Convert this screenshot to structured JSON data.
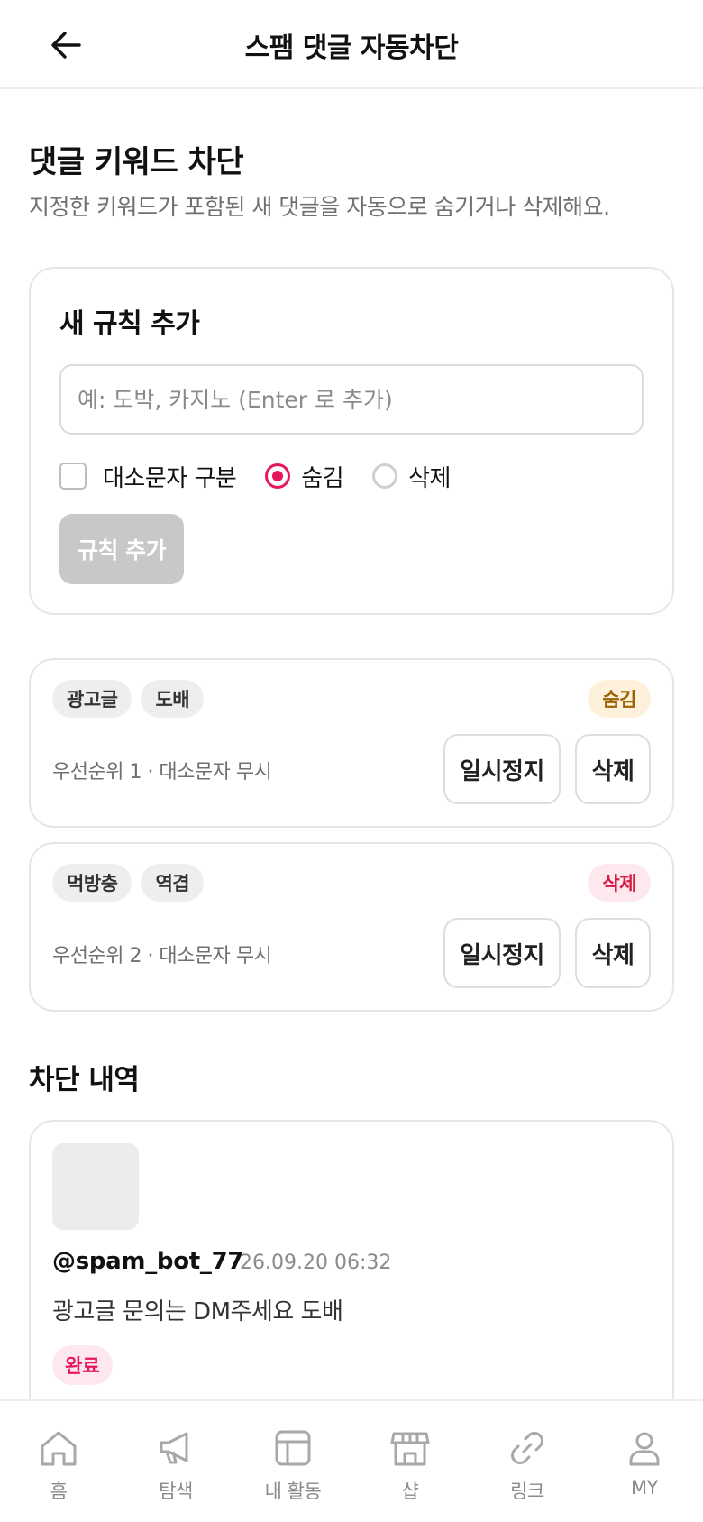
{
  "header": {
    "title": "스팸 댓글 자동차단"
  },
  "section": {
    "title": "댓글 키워드 차단",
    "description": "지정한 키워드가 포함된 새 댓글을 자동으로 숨기거나 삭제해요."
  },
  "add_rule": {
    "title": "새 규칙 추가",
    "input_placeholder": "예: 도박, 카지노 (Enter 로 추가)",
    "input_value": "",
    "case_sensitive_label": "대소문자 구분",
    "case_sensitive_checked": false,
    "mode_options": [
      "숨김",
      "삭제"
    ],
    "selected_mode": "숨김",
    "submit_label": "규칙 추가"
  },
  "rules": [
    {
      "keywords": [
        "광고글",
        "도배"
      ],
      "mode": "숨김",
      "meta": "우선순위 1 · 대소문자 무시",
      "pause_label": "일시정지",
      "delete_label": "삭제"
    },
    {
      "keywords": [
        "먹방충",
        "역겹"
      ],
      "mode": "삭제",
      "meta": "우선순위 2 · 대소문자 무시",
      "pause_label": "일시정지",
      "delete_label": "삭제"
    }
  ],
  "history": {
    "title": "차단 내역",
    "items": [
      {
        "user": "@spam_bot_77",
        "time": "26.09.20 06:32",
        "text": "광고글 문의는 DM주세요 도배",
        "status": "완료"
      }
    ]
  },
  "tabbar": {
    "items": [
      {
        "label": "홈",
        "icon": "home-icon"
      },
      {
        "label": "탐색",
        "icon": "megaphone-icon"
      },
      {
        "label": "내 활동",
        "icon": "layout-icon"
      },
      {
        "label": "샵",
        "icon": "store-icon"
      },
      {
        "label": "링크",
        "icon": "link-icon"
      },
      {
        "label": "MY",
        "icon": "user-icon"
      }
    ]
  },
  "colors": {
    "accent": "#e8175d",
    "hide_badge_bg": "#fdf1dc",
    "hide_badge_text": "#9a6200",
    "delete_badge_bg": "#fde8ed",
    "delete_badge_text": "#d81b45",
    "disabled_button": "#c8c8c8"
  }
}
